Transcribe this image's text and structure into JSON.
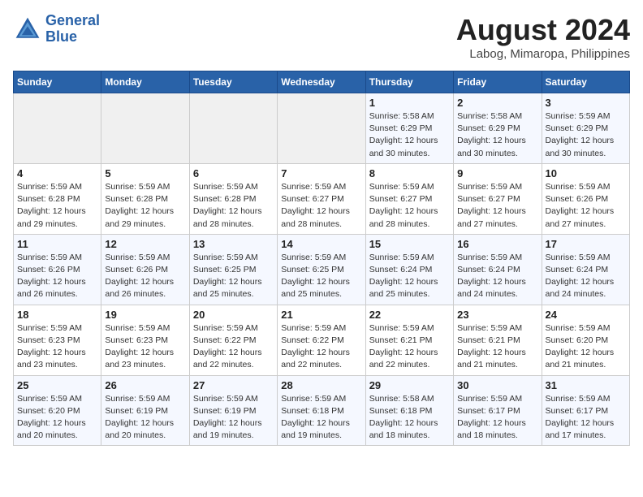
{
  "logo": {
    "line1": "General",
    "line2": "Blue"
  },
  "title": "August 2024",
  "subtitle": "Labog, Mimaropa, Philippines",
  "days_of_week": [
    "Sunday",
    "Monday",
    "Tuesday",
    "Wednesday",
    "Thursday",
    "Friday",
    "Saturday"
  ],
  "weeks": [
    [
      {
        "day": "",
        "info": ""
      },
      {
        "day": "",
        "info": ""
      },
      {
        "day": "",
        "info": ""
      },
      {
        "day": "",
        "info": ""
      },
      {
        "day": "1",
        "info": "Sunrise: 5:58 AM\nSunset: 6:29 PM\nDaylight: 12 hours\nand 30 minutes."
      },
      {
        "day": "2",
        "info": "Sunrise: 5:58 AM\nSunset: 6:29 PM\nDaylight: 12 hours\nand 30 minutes."
      },
      {
        "day": "3",
        "info": "Sunrise: 5:59 AM\nSunset: 6:29 PM\nDaylight: 12 hours\nand 30 minutes."
      }
    ],
    [
      {
        "day": "4",
        "info": "Sunrise: 5:59 AM\nSunset: 6:28 PM\nDaylight: 12 hours\nand 29 minutes."
      },
      {
        "day": "5",
        "info": "Sunrise: 5:59 AM\nSunset: 6:28 PM\nDaylight: 12 hours\nand 29 minutes."
      },
      {
        "day": "6",
        "info": "Sunrise: 5:59 AM\nSunset: 6:28 PM\nDaylight: 12 hours\nand 28 minutes."
      },
      {
        "day": "7",
        "info": "Sunrise: 5:59 AM\nSunset: 6:27 PM\nDaylight: 12 hours\nand 28 minutes."
      },
      {
        "day": "8",
        "info": "Sunrise: 5:59 AM\nSunset: 6:27 PM\nDaylight: 12 hours\nand 28 minutes."
      },
      {
        "day": "9",
        "info": "Sunrise: 5:59 AM\nSunset: 6:27 PM\nDaylight: 12 hours\nand 27 minutes."
      },
      {
        "day": "10",
        "info": "Sunrise: 5:59 AM\nSunset: 6:26 PM\nDaylight: 12 hours\nand 27 minutes."
      }
    ],
    [
      {
        "day": "11",
        "info": "Sunrise: 5:59 AM\nSunset: 6:26 PM\nDaylight: 12 hours\nand 26 minutes."
      },
      {
        "day": "12",
        "info": "Sunrise: 5:59 AM\nSunset: 6:26 PM\nDaylight: 12 hours\nand 26 minutes."
      },
      {
        "day": "13",
        "info": "Sunrise: 5:59 AM\nSunset: 6:25 PM\nDaylight: 12 hours\nand 25 minutes."
      },
      {
        "day": "14",
        "info": "Sunrise: 5:59 AM\nSunset: 6:25 PM\nDaylight: 12 hours\nand 25 minutes."
      },
      {
        "day": "15",
        "info": "Sunrise: 5:59 AM\nSunset: 6:24 PM\nDaylight: 12 hours\nand 25 minutes."
      },
      {
        "day": "16",
        "info": "Sunrise: 5:59 AM\nSunset: 6:24 PM\nDaylight: 12 hours\nand 24 minutes."
      },
      {
        "day": "17",
        "info": "Sunrise: 5:59 AM\nSunset: 6:24 PM\nDaylight: 12 hours\nand 24 minutes."
      }
    ],
    [
      {
        "day": "18",
        "info": "Sunrise: 5:59 AM\nSunset: 6:23 PM\nDaylight: 12 hours\nand 23 minutes."
      },
      {
        "day": "19",
        "info": "Sunrise: 5:59 AM\nSunset: 6:23 PM\nDaylight: 12 hours\nand 23 minutes."
      },
      {
        "day": "20",
        "info": "Sunrise: 5:59 AM\nSunset: 6:22 PM\nDaylight: 12 hours\nand 22 minutes."
      },
      {
        "day": "21",
        "info": "Sunrise: 5:59 AM\nSunset: 6:22 PM\nDaylight: 12 hours\nand 22 minutes."
      },
      {
        "day": "22",
        "info": "Sunrise: 5:59 AM\nSunset: 6:21 PM\nDaylight: 12 hours\nand 22 minutes."
      },
      {
        "day": "23",
        "info": "Sunrise: 5:59 AM\nSunset: 6:21 PM\nDaylight: 12 hours\nand 21 minutes."
      },
      {
        "day": "24",
        "info": "Sunrise: 5:59 AM\nSunset: 6:20 PM\nDaylight: 12 hours\nand 21 minutes."
      }
    ],
    [
      {
        "day": "25",
        "info": "Sunrise: 5:59 AM\nSunset: 6:20 PM\nDaylight: 12 hours\nand 20 minutes."
      },
      {
        "day": "26",
        "info": "Sunrise: 5:59 AM\nSunset: 6:19 PM\nDaylight: 12 hours\nand 20 minutes."
      },
      {
        "day": "27",
        "info": "Sunrise: 5:59 AM\nSunset: 6:19 PM\nDaylight: 12 hours\nand 19 minutes."
      },
      {
        "day": "28",
        "info": "Sunrise: 5:59 AM\nSunset: 6:18 PM\nDaylight: 12 hours\nand 19 minutes."
      },
      {
        "day": "29",
        "info": "Sunrise: 5:58 AM\nSunset: 6:18 PM\nDaylight: 12 hours\nand 18 minutes."
      },
      {
        "day": "30",
        "info": "Sunrise: 5:59 AM\nSunset: 6:17 PM\nDaylight: 12 hours\nand 18 minutes."
      },
      {
        "day": "31",
        "info": "Sunrise: 5:59 AM\nSunset: 6:17 PM\nDaylight: 12 hours\nand 17 minutes."
      }
    ]
  ]
}
